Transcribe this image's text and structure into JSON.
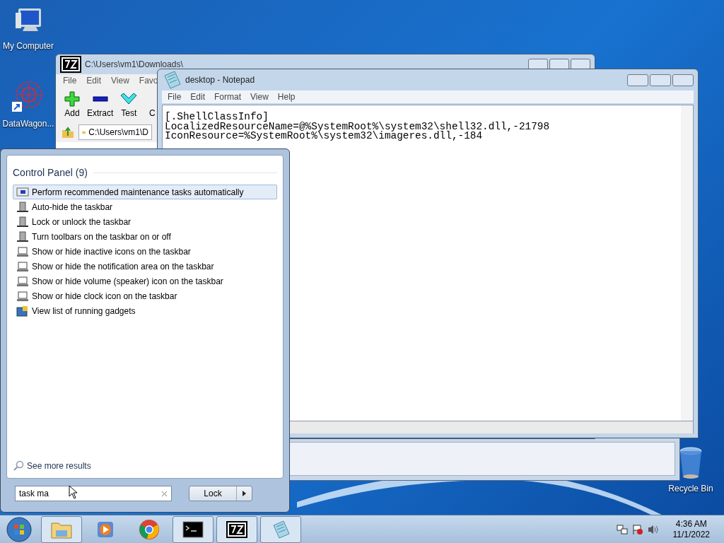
{
  "desktop_icons": [
    {
      "label": "My Computer",
      "kind": "computer"
    },
    {
      "label": "DataWagon...",
      "kind": "shortcut"
    },
    {
      "label": "Recycle Bin",
      "kind": "bin"
    }
  ],
  "archiver_window": {
    "title": "C:\\Users\\vm1\\Downloads\\",
    "menu": [
      "File",
      "Edit",
      "View",
      "Favo"
    ],
    "toolbar": [
      {
        "label": "Add",
        "kind": "add"
      },
      {
        "label": "Extract",
        "kind": "extract"
      },
      {
        "label": "Test",
        "kind": "test"
      },
      {
        "label": "C",
        "kind": "other"
      }
    ],
    "address": "C:\\Users\\vm1\\D"
  },
  "notepad": {
    "title": "desktop - Notepad",
    "menu": [
      "File",
      "Edit",
      "Format",
      "View",
      "Help"
    ],
    "lines": [
      "[.ShellClassInfo]",
      "LocalizedResourceName=@%SystemRoot%\\system32\\shell32.dll,-21798",
      "IconResource=%SystemRoot%\\system32\\imageres.dll,-184"
    ]
  },
  "start_menu": {
    "group": "Control Panel (9)",
    "results": [
      {
        "label": "Perform recommended maintenance tasks automatically",
        "kind": "maintenance",
        "selected": true
      },
      {
        "label": "Auto-hide the taskbar",
        "kind": "taskbar",
        "selected": false
      },
      {
        "label": "Lock or unlock the taskbar",
        "kind": "taskbar",
        "selected": false
      },
      {
        "label": "Turn toolbars on the taskbar on or off",
        "kind": "taskbar",
        "selected": false
      },
      {
        "label": "Show or hide inactive icons on the taskbar",
        "kind": "monitor",
        "selected": false
      },
      {
        "label": "Show or hide the notification area on the taskbar",
        "kind": "monitor",
        "selected": false
      },
      {
        "label": "Show or hide volume (speaker) icon on the taskbar",
        "kind": "monitor",
        "selected": false
      },
      {
        "label": "Show or hide clock icon on the taskbar",
        "kind": "monitor",
        "selected": false
      },
      {
        "label": "View list of running gadgets",
        "kind": "gadgets",
        "selected": false
      }
    ],
    "see_more": "See more results",
    "search_value": "task ma",
    "power_button": "Lock"
  },
  "taskbar": {
    "apps": [
      {
        "kind": "explorer",
        "running": true
      },
      {
        "kind": "media",
        "running": false
      },
      {
        "kind": "chrome",
        "running": false
      },
      {
        "kind": "console",
        "running": true
      },
      {
        "kind": "archiver",
        "running": true
      },
      {
        "kind": "notepad",
        "running": true
      }
    ],
    "clock": {
      "time": "4:36 AM",
      "date": "11/1/2022"
    }
  }
}
